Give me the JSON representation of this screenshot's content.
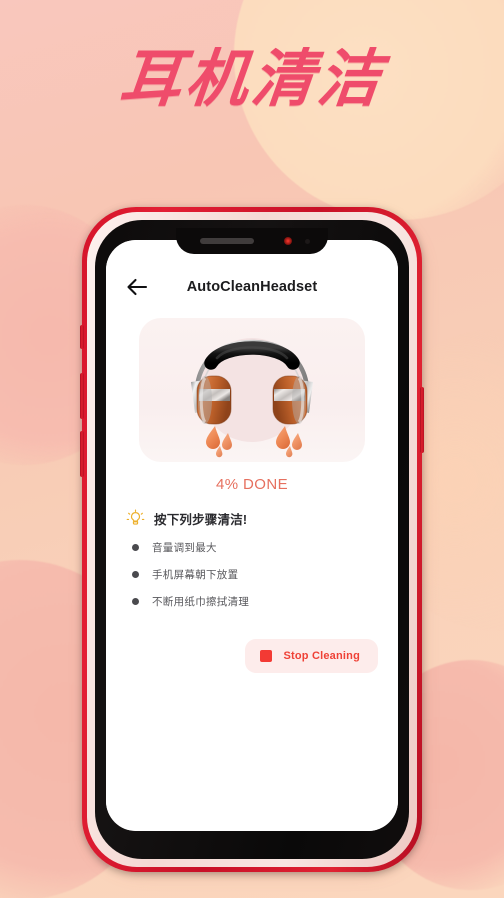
{
  "hero": {
    "title": "耳机清洁",
    "title_color": "#ef4c6b"
  },
  "phone": {
    "frame_color": "#d5142a",
    "body_color": "#0d0b0b",
    "buttons": {
      "silent": "silent-switch",
      "volume_up": "volume-up-button",
      "volume_down": "volume-down-button",
      "power": "power-button"
    }
  },
  "app": {
    "appbar": {
      "back_icon": "arrow-left-icon",
      "title": "AutoCleanHeadset"
    },
    "illustration": {
      "name": "headphones-dripping-water-illustration",
      "headband_color": "#1a1a1a",
      "earcup_color": "#c96a33",
      "accent_color": "#c9c9c9",
      "droplet_color": "#f08a5c",
      "card_background": "#fbf2f1"
    },
    "progress": {
      "label": "4% DONE",
      "percent": 4,
      "color": "#e6705f"
    },
    "tip": {
      "icon": "lightbulb-icon",
      "icon_color": "#f0b429",
      "heading": "按下列步骤清洁!"
    },
    "steps": [
      {
        "label": "音量调到最大"
      },
      {
        "label": "手机屏幕朝下放置"
      },
      {
        "label": "不断用纸巾擦拭清理"
      }
    ],
    "stop_button": {
      "label": "Stop Cleaning",
      "icon": "stop-square-icon",
      "text_color": "#ef4136",
      "background": "#fdeceb"
    }
  }
}
